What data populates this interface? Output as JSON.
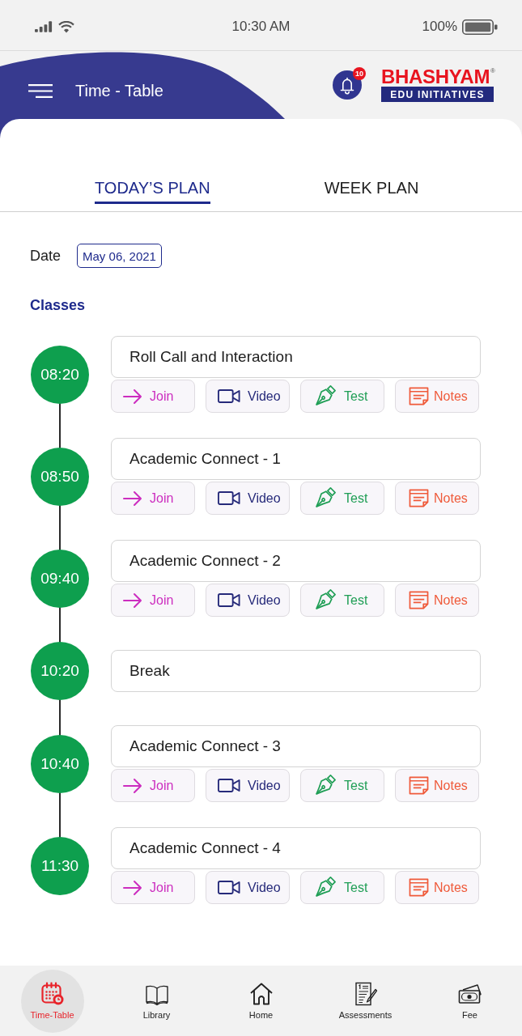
{
  "status_bar": {
    "time": "10:30 AM",
    "battery": "100%"
  },
  "header": {
    "title": "Time - Table",
    "notification_count": "10",
    "logo": {
      "name": "BHASHYAM",
      "registered": "®",
      "tagline": "EDU INITIATIVES"
    }
  },
  "tabs": [
    {
      "label": "TODAY’S PLAN",
      "selected": true
    },
    {
      "label": "WEEK PLAN",
      "selected": false
    }
  ],
  "date": {
    "label": "Date",
    "value": "May 06, 2021"
  },
  "section_title": "Classes",
  "schedule": [
    {
      "time": "08:20",
      "title": "Roll Call and Interaction",
      "actions": [
        {
          "kind": "join",
          "label": "Join"
        },
        {
          "kind": "video",
          "label": "Video"
        },
        {
          "kind": "test",
          "label": "Test"
        },
        {
          "kind": "notes",
          "label": "Notes"
        }
      ]
    },
    {
      "time": "08:50",
      "title": "Academic Connect - 1",
      "actions": [
        {
          "kind": "join",
          "label": "Join"
        },
        {
          "kind": "video",
          "label": "Video"
        },
        {
          "kind": "test",
          "label": "Test"
        },
        {
          "kind": "notes",
          "label": "Notes"
        }
      ]
    },
    {
      "time": "09:40",
      "title": "Academic Connect - 2",
      "actions": [
        {
          "kind": "join",
          "label": "Join"
        },
        {
          "kind": "video",
          "label": "Video"
        },
        {
          "kind": "test",
          "label": "Test"
        },
        {
          "kind": "notes",
          "label": "Notes"
        }
      ]
    },
    {
      "time": "10:20",
      "title": "Break"
    },
    {
      "time": "10:40",
      "title": "Academic Connect - 3",
      "actions": [
        {
          "kind": "join",
          "label": "Join"
        },
        {
          "kind": "video",
          "label": "Video"
        },
        {
          "kind": "test",
          "label": "Test"
        },
        {
          "kind": "notes",
          "label": "Notes"
        }
      ]
    },
    {
      "time": "11:30",
      "title": "Academic Connect - 4",
      "actions": [
        {
          "kind": "join",
          "label": "Join"
        },
        {
          "kind": "video",
          "label": "Video"
        },
        {
          "kind": "test",
          "label": "Test"
        },
        {
          "kind": "notes",
          "label": "Notes"
        }
      ]
    }
  ],
  "bottom_nav": [
    {
      "kind": "timetable",
      "label": "Time-Table",
      "selected": true
    },
    {
      "kind": "library",
      "label": "Library",
      "selected": false
    },
    {
      "kind": "home",
      "label": "Home",
      "selected": false
    },
    {
      "kind": "assessments",
      "label": "Assessments",
      "selected": false
    },
    {
      "kind": "fee",
      "label": "Fee",
      "selected": false
    }
  ]
}
